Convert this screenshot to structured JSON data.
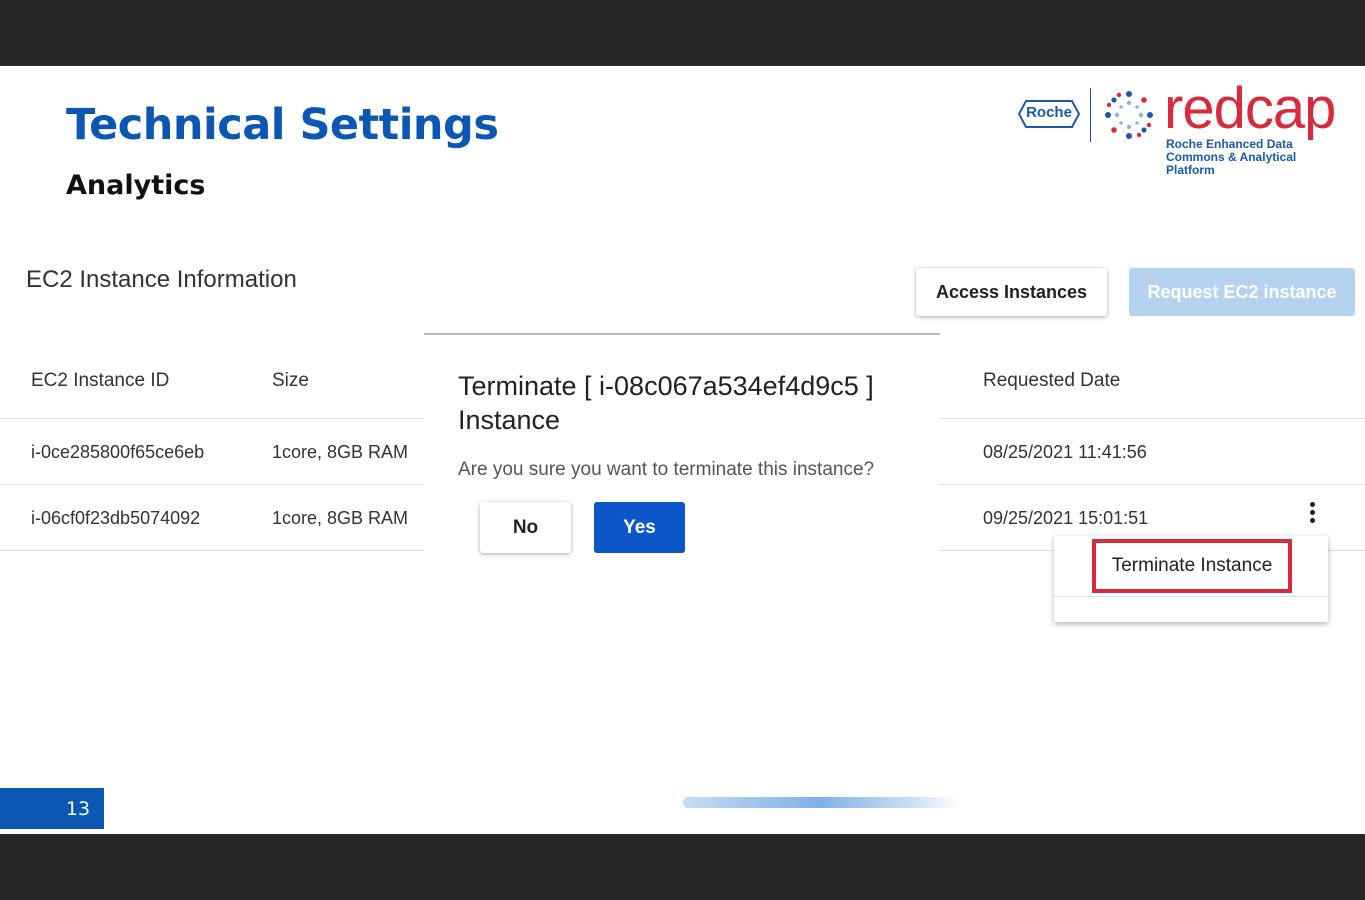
{
  "slide": {
    "title": "Technical Settings",
    "subtitle": "Analytics",
    "page_number": "13"
  },
  "logo": {
    "roche": "Roche",
    "redcap": "redcap",
    "tagline_line1": "Roche Enhanced Data",
    "tagline_line2": "Commons & Analytical Platform"
  },
  "app": {
    "section_title": "EC2 Instance Information",
    "access_button": "Access Instances",
    "request_button": "Request EC2 instance",
    "table": {
      "headers": {
        "id": "EC2 Instance ID",
        "size": "Size",
        "requested": "Requested Date"
      },
      "rows": [
        {
          "id": "i-0ce285800f65ce6eb",
          "size": "1core, 8GB RAM",
          "requested": "08/25/2021 11:41:56"
        },
        {
          "id": "i-06cf0f23db5074092",
          "size": "1core, 8GB RAM",
          "requested": "09/25/2021 15:01:51"
        }
      ]
    },
    "menu": {
      "terminate": "Terminate Instance"
    },
    "dialog": {
      "title": "Terminate [ i-08c067a534ef4d9c5 ] Instance",
      "message": "Are you sure you want to terminate this instance?",
      "no": "No",
      "yes": "Yes"
    }
  },
  "colors": {
    "title_blue": "#0b57b3",
    "redcap_red": "#d82a3a",
    "highlight_red": "#d72a3a",
    "primary_button": "#0b57c7",
    "disabled_button": "#b5d2ee"
  }
}
